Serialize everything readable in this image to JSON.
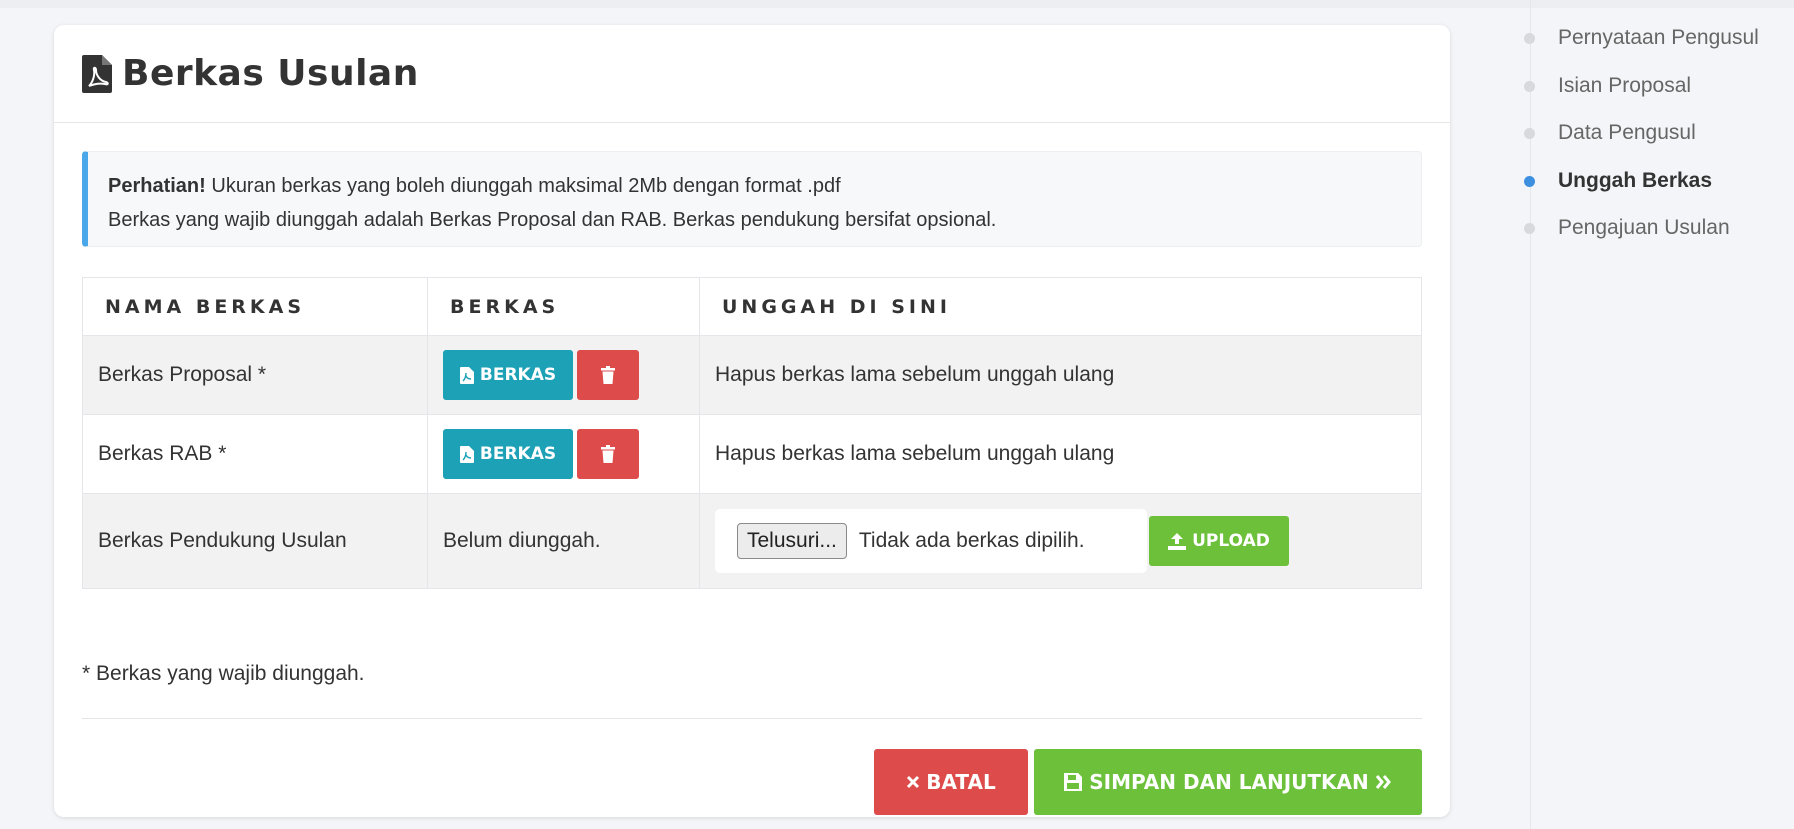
{
  "card": {
    "title": "Berkas Usulan",
    "title_icon": "file-pdf-icon"
  },
  "alert": {
    "strong": "Perhatian!",
    "line1": " Ukuran berkas yang boleh diunggah maksimal 2Mb dengan format .pdf",
    "line2": "Berkas yang wajib diunggah adalah Berkas Proposal dan RAB. Berkas pendukung bersifat opsional.",
    "accent_color": "#4aa8ea"
  },
  "table": {
    "headers": [
      "NAMA BERKAS",
      "BERKAS",
      "UNGGAH DI SINI"
    ],
    "rows": [
      {
        "name": "Berkas Proposal *",
        "file_button": "BERKAS",
        "upload_note": "Hapus berkas lama sebelum unggah ulang"
      },
      {
        "name": "Berkas RAB *",
        "file_button": "BERKAS",
        "upload_note": "Hapus berkas lama sebelum unggah ulang"
      },
      {
        "name": "Berkas Pendukung Usulan",
        "status": "Belum diunggah.",
        "browse_label": "Telusuri...",
        "file_input_value": "Tidak ada berkas dipilih.",
        "upload_button": "UPLOAD"
      }
    ]
  },
  "note": "* Berkas yang wajib diunggah.",
  "actions": {
    "cancel_label": "BATAL",
    "save_label": "SIMPAN DAN LANJUTKAN"
  },
  "colors": {
    "info": "#1ca1b6",
    "danger": "#de4b4b",
    "success": "#6cc03a",
    "active_step": "#3d8fe0"
  },
  "steps": [
    {
      "label": "Pernyataan Pengusul",
      "active": false
    },
    {
      "label": "Isian Proposal",
      "active": false
    },
    {
      "label": "Data Pengusul",
      "active": false
    },
    {
      "label": "Unggah Berkas",
      "active": true
    },
    {
      "label": "Pengajuan Usulan",
      "active": false
    }
  ]
}
